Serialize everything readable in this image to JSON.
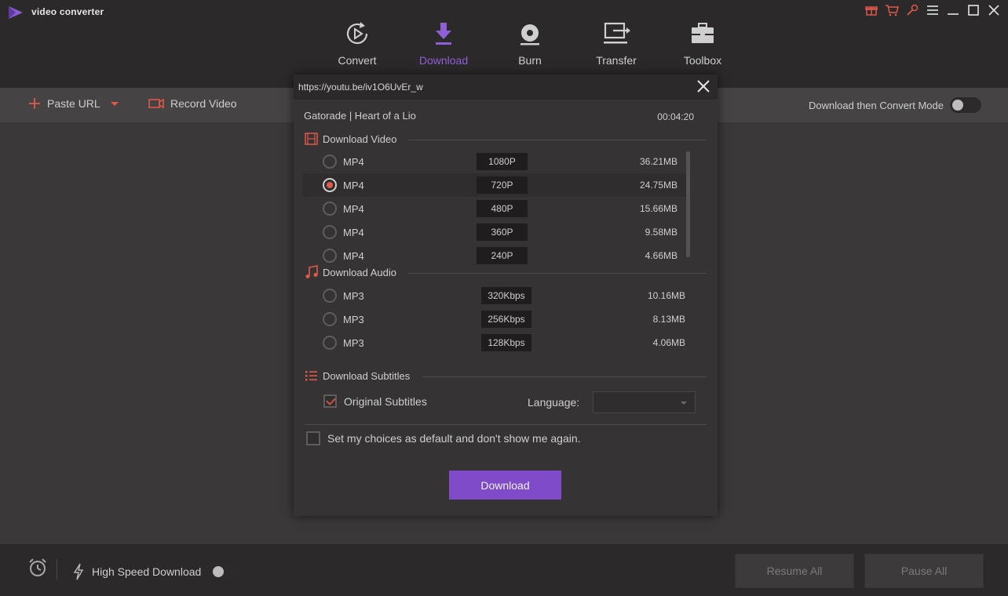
{
  "app": {
    "title": "video converter"
  },
  "nav": {
    "items": [
      {
        "label": "Convert",
        "icon": "convert-icon"
      },
      {
        "label": "Download",
        "icon": "download-icon",
        "active": true
      },
      {
        "label": "Burn",
        "icon": "disc-icon"
      },
      {
        "label": "Transfer",
        "icon": "transfer-icon"
      },
      {
        "label": "Toolbox",
        "icon": "toolbox-icon"
      }
    ]
  },
  "toolbar": {
    "paste_url": "Paste URL",
    "record_video": "Record Video",
    "convert_mode": "Download then Convert Mode"
  },
  "dialog": {
    "url": "https://youtu.be/iv1O6UvEr_w",
    "video_title": "Gatorade | Heart of a Lio",
    "duration": "00:04:20",
    "video_section": "Download Video",
    "video_options": [
      {
        "format": "MP4",
        "quality": "1080P",
        "size": "36.21MB",
        "selected": false
      },
      {
        "format": "MP4",
        "quality": "720P",
        "size": "24.75MB",
        "selected": true
      },
      {
        "format": "MP4",
        "quality": "480P",
        "size": "15.66MB",
        "selected": false
      },
      {
        "format": "MP4",
        "quality": "360P",
        "size": "9.58MB",
        "selected": false
      },
      {
        "format": "MP4",
        "quality": "240P",
        "size": "4.66MB",
        "selected": false
      }
    ],
    "audio_section": "Download Audio",
    "audio_options": [
      {
        "format": "MP3",
        "quality": "320Kbps",
        "size": "10.16MB",
        "selected": false
      },
      {
        "format": "MP3",
        "quality": "256Kbps",
        "size": "8.13MB",
        "selected": false
      },
      {
        "format": "MP3",
        "quality": "128Kbps",
        "size": "4.06MB",
        "selected": false
      }
    ],
    "subtitles_section": "Download Subtitles",
    "original_subtitles": "Original Subtitles",
    "original_subtitles_checked": true,
    "language_label": "Language:",
    "language_value": "",
    "default_choice": "Set my choices as default and don't show me again.",
    "default_choice_checked": false,
    "download_button": "Download"
  },
  "bottom": {
    "high_speed": "High Speed Download",
    "resume_all": "Resume All",
    "pause_all": "Pause All"
  },
  "colors": {
    "accent_purple": "#7f4bc9",
    "accent_red": "#e05a48",
    "background": "#3a3838"
  }
}
